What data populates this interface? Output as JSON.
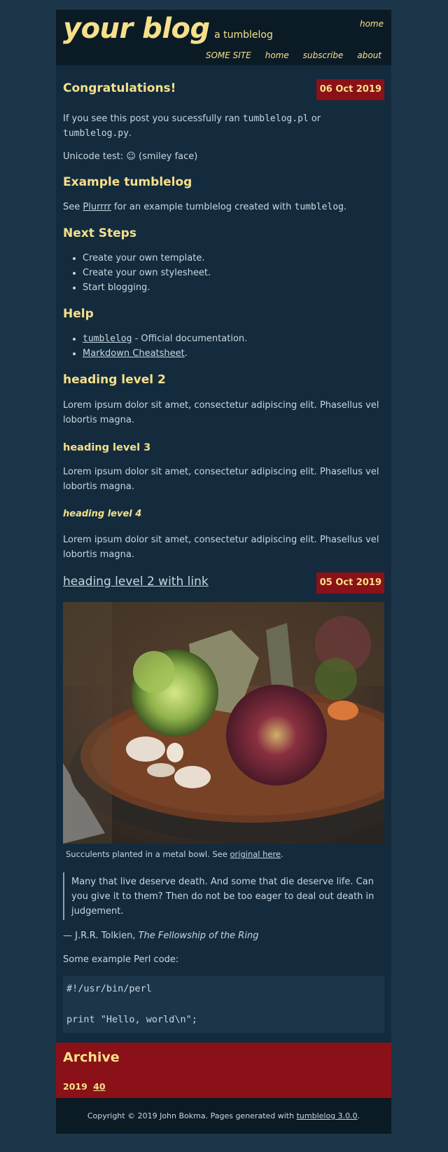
{
  "header": {
    "title": "your blog",
    "subtitle": "a tumblelog",
    "top_home": "home",
    "nav": [
      "SOME SITE",
      "home",
      "subscribe",
      "about"
    ]
  },
  "post1": {
    "title": "Congratulations!",
    "date": "06 Oct 2019",
    "p1_before": "If you see this post you sucessfully ran ",
    "p1_code1": "tumblelog.pl",
    "p1_mid": " or",
    "p1_code2": "tumblelog.py",
    "p1_after": ".",
    "unicode_test": "Unicode test: ☺ (smiley face)",
    "h_example": "Example tumblelog",
    "example_see": "See ",
    "example_link": "Plurrrr",
    "example_mid": " for an example tumblelog created with ",
    "example_code": "tumblelog",
    "example_end": ".",
    "h_next": "Next Steps",
    "next_steps": [
      "Create your own template.",
      "Create your own stylesheet.",
      "Start blogging."
    ],
    "h_help": "Help",
    "help_link1": "tumblelog",
    "help_text1": " - Official documentation.",
    "help_link2": "Markdown Cheatsheet",
    "help_text2": ".",
    "h2": "heading level 2",
    "lorem": "Lorem ipsum dolor sit amet, consectetur adipiscing elit. Phasellus vel lobortis magna.",
    "h3": "heading level 3",
    "h4": "heading level 4"
  },
  "post2": {
    "title": "heading level 2 with link",
    "date": "05 Oct 2019",
    "caption_before": "Succulents planted in a metal bowl. See ",
    "caption_link": "original here",
    "caption_after": ".",
    "quote": "Many that live deserve death. And some that die deserve life. Can you give it to them? Then do not be too eager to deal out death in judgement.",
    "attribution_prefix": "— J.R.R. Tolkien, ",
    "attribution_work": "The Fellowship of the Ring",
    "code_intro": "Some example Perl code:",
    "code_line1": "#!/usr/bin/perl",
    "code_line2": "print \"Hello, world\\n\";"
  },
  "archive": {
    "title": "Archive",
    "year": "2019",
    "week": "40"
  },
  "footer": {
    "copyright": "Copyright © 2019 John Bokma. Pages generated with ",
    "generator_link": "tumblelog 3.0.0",
    "end": "."
  },
  "colors": {
    "background": "#1c3549",
    "panel": "#132b3d",
    "header": "#0b1b26",
    "accent": "#f7e08a",
    "date_badge": "#8a1117"
  }
}
